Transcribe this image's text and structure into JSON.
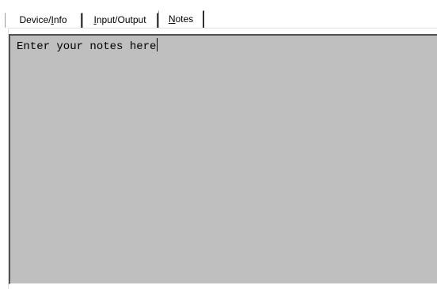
{
  "tabs": [
    {
      "id": "device_info",
      "label_pre": "Device/",
      "label_accel": "I",
      "label_post": "nfo",
      "active": false
    },
    {
      "id": "input_output",
      "label_pre": "",
      "label_accel": "I",
      "label_post": "nput/Output",
      "active": false
    },
    {
      "id": "notes",
      "label_pre": "",
      "label_accel": "N",
      "label_post": "otes",
      "active": true
    }
  ],
  "notes": {
    "value": "Enter your notes here"
  },
  "colors": {
    "window_background": "#ffffff",
    "text_area_background": "#bfbfbf",
    "text": "#000000"
  }
}
